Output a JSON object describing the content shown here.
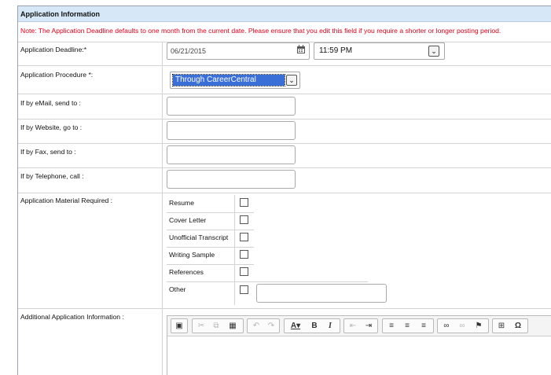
{
  "section_title": "Application Information",
  "note": "Note: The Application Deadline defaults to one month from the current date.  Please ensure that you edit this field if you require a shorter or longer posting period.",
  "fields": {
    "deadline_label": "Application Deadline:*",
    "deadline_date": "06/21/2015",
    "deadline_time": "11:59 PM",
    "procedure_label": "Application Procedure *:",
    "procedure_value": "Through CareerCentral",
    "email_label": "If by eMail, send to :",
    "website_label": "If by Website, go to :",
    "fax_label": "If by Fax, send to :",
    "telephone_label": "If by Telephone, call :"
  },
  "materials": {
    "label": "Application Material Required :",
    "items": [
      {
        "label": "Resume",
        "checked": false
      },
      {
        "label": "Cover Letter",
        "checked": false
      },
      {
        "label": "Unofficial Transcript",
        "checked": false
      },
      {
        "label": "Writing Sample",
        "checked": false
      },
      {
        "label": "References",
        "checked": false
      },
      {
        "label": "Other",
        "checked": false
      }
    ]
  },
  "additional": {
    "label": "Additional Application Information :"
  },
  "colors": {
    "header_bg": "#d6e8f7",
    "note": "#e0001a",
    "selection": "#3a6fd8"
  },
  "toolbar_icons": [
    "preview-icon",
    "cut-icon",
    "copy-icon",
    "paste-icon",
    "undo-icon",
    "redo-icon",
    "font-color-icon",
    "bold-icon",
    "italic-icon",
    "outdent-icon",
    "indent-icon",
    "align-left-icon",
    "align-center-icon",
    "align-right-icon",
    "link-icon",
    "unlink-icon",
    "anchor-flag-icon",
    "table-icon",
    "special-char-icon"
  ]
}
